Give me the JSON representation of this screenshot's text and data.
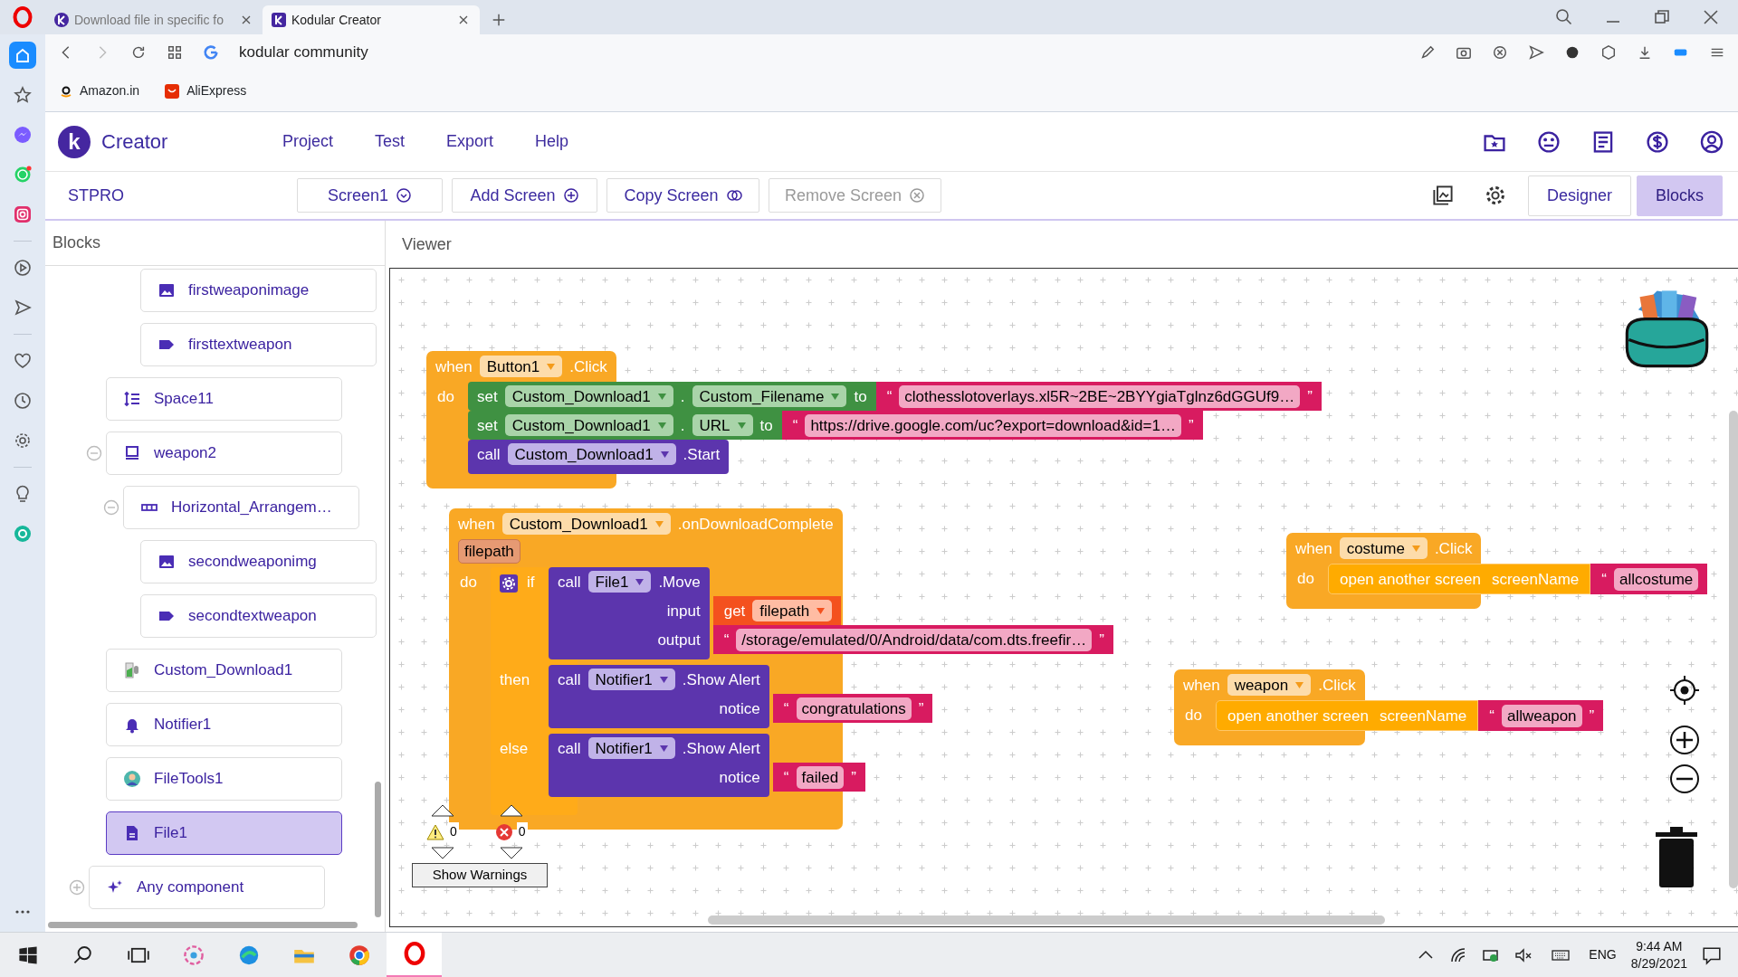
{
  "browser": {
    "tabs": [
      {
        "title": "Download file in specific fo",
        "selected": false
      },
      {
        "title": "Kodular Creator",
        "selected": true
      }
    ],
    "address": "kodular community",
    "bookmarks": [
      {
        "label": "Amazon.in",
        "kind": "amazon"
      },
      {
        "label": "AliExpress",
        "kind": "aliexpress"
      }
    ],
    "sidebar": [
      {
        "kind": "home",
        "selected": true
      },
      {
        "kind": "star",
        "selected": false
      },
      {
        "kind": "messenger",
        "selected": false
      },
      {
        "kind": "whatsapp",
        "selected": false
      },
      {
        "kind": "instagram",
        "selected": false
      },
      {
        "kind": "separator"
      },
      {
        "kind": "player",
        "selected": false
      },
      {
        "kind": "send",
        "selected": false
      },
      {
        "kind": "separator"
      },
      {
        "kind": "heart",
        "selected": false
      },
      {
        "kind": "clock",
        "selected": false
      },
      {
        "kind": "gear",
        "selected": false
      },
      {
        "kind": "separator"
      },
      {
        "kind": "bulb",
        "selected": false
      },
      {
        "kind": "circle-a",
        "selected": false
      }
    ]
  },
  "app": {
    "logo_letter": "k",
    "brand": "Creator",
    "menu": [
      "Project",
      "Test",
      "Export",
      "Help"
    ],
    "project": "STPRO",
    "screen_buttons": [
      {
        "label": "Screen1",
        "kind": "dropdown",
        "disabled": false
      },
      {
        "label": "Add Screen",
        "kind": "add",
        "disabled": false
      },
      {
        "label": "Copy Screen",
        "kind": "copy",
        "disabled": false
      },
      {
        "label": "Remove Screen",
        "kind": "remove",
        "disabled": true
      }
    ],
    "views": [
      {
        "label": "Designer",
        "selected": false
      },
      {
        "label": "Blocks",
        "selected": true
      }
    ]
  },
  "blocks_panel": {
    "title": "Blocks",
    "tree": [
      {
        "children": [
          {
            "children": [
              {
                "children": [
                  {
                    "label": "firstweaponimage",
                    "kind": "image",
                    "selected": false
                  },
                  {
                    "label": "firsttextweapon",
                    "kind": "label",
                    "selected": false
                  }
                ]
              }
            ]
          },
          {
            "label": "Space11",
            "kind": "space",
            "selected": false
          },
          {
            "label": "weapon2",
            "kind": "card",
            "selected": false,
            "expanded": true,
            "children": [
              {
                "label": "Horizontal_Arrangem…",
                "kind": "arrangement",
                "selected": false,
                "expanded": true,
                "children": [
                  {
                    "label": "secondweaponimg",
                    "kind": "image",
                    "selected": false
                  },
                  {
                    "label": "secondtextweapon",
                    "kind": "label",
                    "selected": false
                  }
                ]
              }
            ]
          },
          {
            "label": "Custom_Download1",
            "kind": "download",
            "selected": false
          },
          {
            "label": "Notifier1",
            "kind": "notifier",
            "selected": false
          },
          {
            "label": "FileTools1",
            "kind": "filetools",
            "selected": false
          },
          {
            "label": "File1",
            "kind": "file",
            "selected": true
          }
        ]
      },
      {
        "label": "Any component",
        "kind": "any",
        "selected": false,
        "expanded": false
      }
    ]
  },
  "viewer": {
    "title": "Viewer",
    "blocks": [
      {
        "kind": "event",
        "keyword": "when",
        "component": "Button1",
        "event": ".Click",
        "do": "do",
        "statements": [
          {
            "kind": "setter",
            "keyword": "set",
            "component": "Custom_Download1",
            "dot": ".",
            "property": "Custom_Filename",
            "to": "to",
            "value": {
              "kind": "text",
              "open": "“",
              "text": "clothesslotoverlays.xl5R~2BE~2BYYgiaTglnz6dGGUf9…",
              "close": "”"
            }
          },
          {
            "kind": "setter",
            "keyword": "set",
            "component": "Custom_Download1",
            "dot": ".",
            "property": "URL",
            "to": "to",
            "value": {
              "kind": "text",
              "open": "“",
              "text": "https://drive.google.com/uc?export=download&id=1…",
              "close": "”"
            }
          },
          {
            "kind": "call",
            "keyword": "call",
            "component": "Custom_Download1",
            "method": ".Start"
          }
        ]
      },
      {
        "kind": "event",
        "keyword": "when",
        "component": "Custom_Download1",
        "event": ".onDownloadComplete",
        "params": [
          "filepath"
        ],
        "do": "do",
        "statements": [
          {
            "kind": "if",
            "keyword": "if",
            "condition": {
              "kind": "call",
              "keyword": "call",
              "component": "File1",
              "method": ".Move",
              "args": [
                {
                  "name": "input",
                  "value": {
                    "kind": "get",
                    "keyword": "get",
                    "variable": "filepath"
                  }
                },
                {
                  "name": "output",
                  "value": {
                    "kind": "text",
                    "open": "“",
                    "text": "/storage/emulated/0/Android/data/com.dts.freefir…",
                    "close": "”"
                  }
                }
              ]
            },
            "branches": [
              {
                "label": "then",
                "statements": [
                  {
                    "kind": "call",
                    "keyword": "call",
                    "component": "Notifier1",
                    "method": ".Show Alert",
                    "args": [
                      {
                        "name": "notice",
                        "value": {
                          "kind": "text",
                          "open": "“",
                          "text": "congratulations",
                          "close": "”"
                        }
                      }
                    ]
                  }
                ]
              },
              {
                "label": "else",
                "statements": [
                  {
                    "kind": "call",
                    "keyword": "call",
                    "component": "Notifier1",
                    "method": ".Show Alert",
                    "args": [
                      {
                        "name": "notice",
                        "value": {
                          "kind": "text",
                          "open": "“",
                          "text": "failed",
                          "close": "”"
                        }
                      }
                    ]
                  }
                ]
              }
            ]
          }
        ]
      },
      {
        "kind": "event",
        "keyword": "when",
        "component": "costume",
        "event": ".Click",
        "do": "do",
        "statements": [
          {
            "kind": "open_screen",
            "label": "open another screen",
            "arg": "screenName",
            "value": {
              "kind": "text",
              "open": "“",
              "text": "allcostume"
            }
          }
        ]
      },
      {
        "kind": "event",
        "keyword": "when",
        "component": "weapon",
        "event": ".Click",
        "do": "do",
        "statements": [
          {
            "kind": "open_screen",
            "label": "open another screen",
            "arg": "screenName",
            "value": {
              "kind": "text",
              "open": "“",
              "text": "allweapon",
              "close": "”"
            }
          }
        ]
      }
    ],
    "warnings": {
      "warning_count": "0",
      "error_count": "0",
      "button": "Show Warnings"
    }
  },
  "taskbar": {
    "language": "ENG",
    "time": "9:44 AM",
    "date": "8/29/2021"
  }
}
